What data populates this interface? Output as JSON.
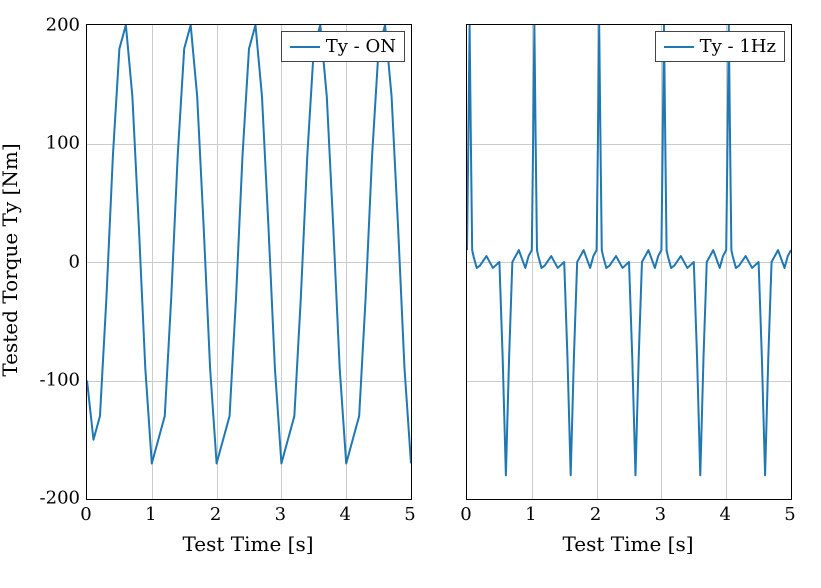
{
  "chart_data": [
    {
      "type": "line",
      "title": "",
      "xlabel": "Test Time [s]",
      "ylabel": "Tested Torque Ty [Nm]",
      "xlim": [
        0,
        5
      ],
      "ylim": [
        -200,
        200
      ],
      "xticks": [
        0,
        1,
        2,
        3,
        4,
        5
      ],
      "yticks": [
        -200,
        -100,
        0,
        100,
        200
      ],
      "legend": "Ty - ON",
      "legend_position": "upper-right",
      "series": [
        {
          "name": "Ty - ON",
          "color": "#1f77b4",
          "x": [
            0.0,
            0.1,
            0.2,
            0.3,
            0.4,
            0.5,
            0.6,
            0.7,
            0.8,
            0.9,
            1.0,
            1.1,
            1.2,
            1.3,
            1.4,
            1.5,
            1.6,
            1.7,
            1.8,
            1.9,
            2.0,
            2.1,
            2.2,
            2.3,
            2.4,
            2.5,
            2.6,
            2.7,
            2.8,
            2.9,
            3.0,
            3.1,
            3.2,
            3.3,
            3.4,
            3.5,
            3.6,
            3.7,
            3.8,
            3.9,
            4.0,
            4.1,
            4.2,
            4.3,
            4.4,
            4.5,
            4.6,
            4.7,
            4.8,
            4.9,
            5.0
          ],
          "values": [
            -100,
            -150,
            -130,
            -30,
            90,
            180,
            200,
            140,
            30,
            -90,
            -170,
            -150,
            -130,
            -30,
            90,
            180,
            200,
            140,
            30,
            -90,
            -170,
            -150,
            -130,
            -30,
            90,
            180,
            200,
            140,
            30,
            -90,
            -170,
            -150,
            -130,
            -30,
            90,
            180,
            200,
            140,
            30,
            -90,
            -170,
            -150,
            -130,
            -30,
            90,
            180,
            200,
            140,
            30,
            -90,
            -170
          ]
        }
      ]
    },
    {
      "type": "line",
      "title": "",
      "xlabel": "Test Time [s]",
      "ylabel": "",
      "xlim": [
        0,
        5
      ],
      "ylim": [
        -200,
        200
      ],
      "xticks": [
        0,
        1,
        2,
        3,
        4,
        5
      ],
      "yticks": [
        -200,
        -100,
        0,
        100,
        200
      ],
      "legend": "Ty - 1Hz",
      "legend_position": "upper-right",
      "series": [
        {
          "name": "Ty - 1Hz",
          "color": "#1f77b4",
          "x": [
            0.0,
            0.02,
            0.04,
            0.06,
            0.08,
            0.1,
            0.15,
            0.2,
            0.3,
            0.4,
            0.5,
            0.55,
            0.6,
            0.65,
            0.7,
            0.8,
            0.9,
            0.95,
            1.0,
            1.02,
            1.04,
            1.06,
            1.08,
            1.1,
            1.15,
            1.2,
            1.3,
            1.4,
            1.5,
            1.55,
            1.6,
            1.65,
            1.7,
            1.8,
            1.9,
            1.95,
            2.0,
            2.02,
            2.04,
            2.06,
            2.08,
            2.1,
            2.15,
            2.2,
            2.3,
            2.4,
            2.5,
            2.55,
            2.6,
            2.65,
            2.7,
            2.8,
            2.9,
            2.95,
            3.0,
            3.02,
            3.04,
            3.06,
            3.08,
            3.1,
            3.15,
            3.2,
            3.3,
            3.4,
            3.5,
            3.55,
            3.6,
            3.65,
            3.7,
            3.8,
            3.9,
            3.95,
            4.0,
            4.02,
            4.04,
            4.06,
            4.08,
            4.1,
            4.15,
            4.2,
            4.3,
            4.4,
            4.5,
            4.55,
            4.6,
            4.65,
            4.7,
            4.8,
            4.9,
            4.95,
            5.0
          ],
          "values": [
            10,
            100,
            200,
            100,
            10,
            5,
            -5,
            -3,
            5,
            -5,
            0,
            -80,
            -180,
            -80,
            0,
            10,
            -5,
            5,
            10,
            100,
            200,
            100,
            10,
            5,
            -5,
            -3,
            5,
            -5,
            0,
            -80,
            -180,
            -80,
            0,
            10,
            -5,
            5,
            10,
            100,
            200,
            100,
            10,
            5,
            -5,
            -3,
            5,
            -5,
            0,
            -80,
            -180,
            -80,
            0,
            10,
            -5,
            5,
            10,
            100,
            200,
            100,
            10,
            5,
            -5,
            -3,
            5,
            -5,
            0,
            -80,
            -180,
            -80,
            0,
            10,
            -5,
            5,
            10,
            100,
            200,
            100,
            10,
            5,
            -5,
            -3,
            5,
            -5,
            0,
            -80,
            -180,
            -80,
            0,
            10,
            -5,
            5,
            10
          ]
        }
      ]
    }
  ],
  "labels": {
    "x": "Test Time [s]",
    "y": "Tested Torque Ty [Nm]",
    "legend_left": "Ty - ON",
    "legend_right": "Ty - 1Hz"
  }
}
